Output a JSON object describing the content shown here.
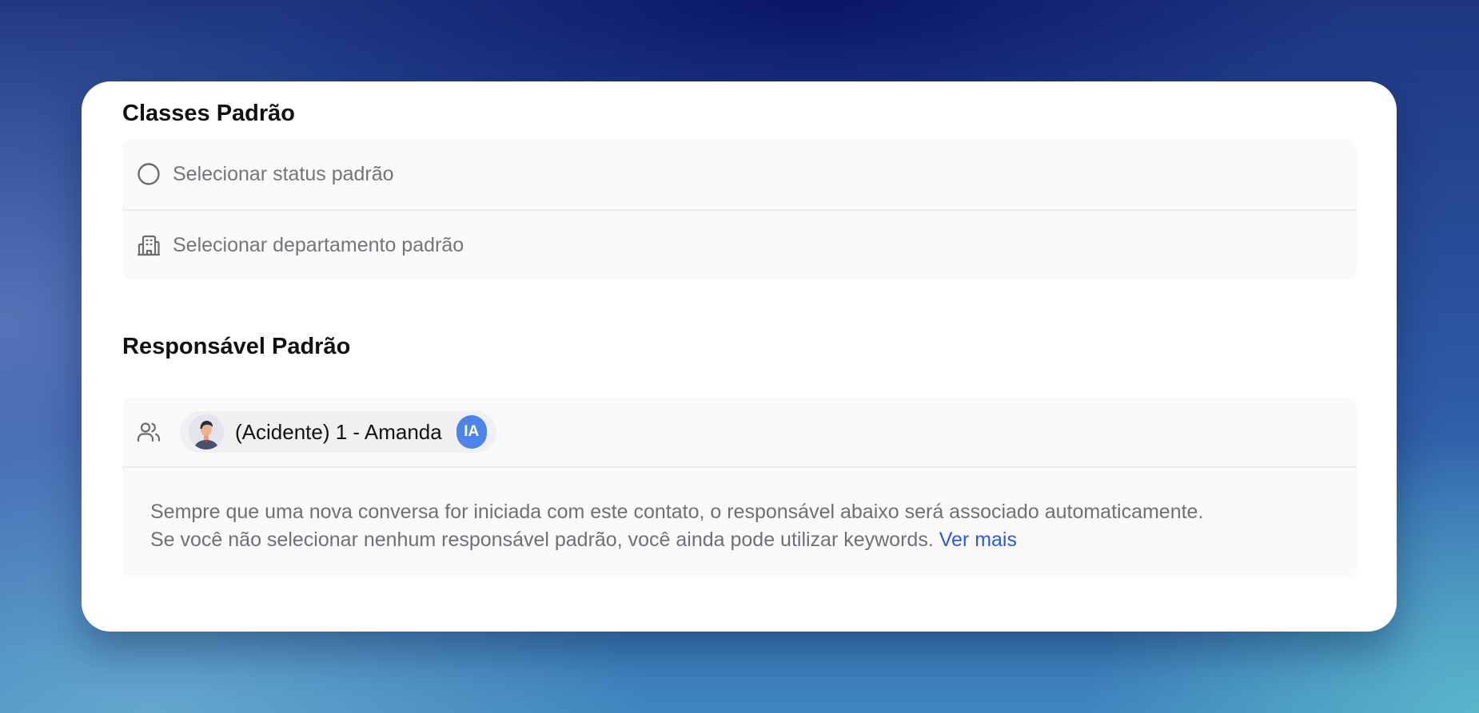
{
  "classes": {
    "title": "Classes Padrão",
    "status_placeholder": "Selecionar status padrão",
    "department_placeholder": "Selecionar departamento padrão"
  },
  "responsible": {
    "title": "Responsável Padrão",
    "assignee": {
      "name": "(Acidente) 1 - Amanda",
      "badge": "IA"
    },
    "help_text_line1": "Sempre que uma nova conversa for iniciada com este contato, o responsável abaixo será associado automaticamente.",
    "help_text_line2": "Se você não selecionar nenhum responsável padrão, você ainda pode utilizar keywords.",
    "link_label": "Ver mais"
  },
  "colors": {
    "accent": "#2a5bd7",
    "badge": "#4d84e8"
  },
  "icons": {
    "status": "circle-icon",
    "department": "building-icon",
    "responsible": "users-icon"
  }
}
